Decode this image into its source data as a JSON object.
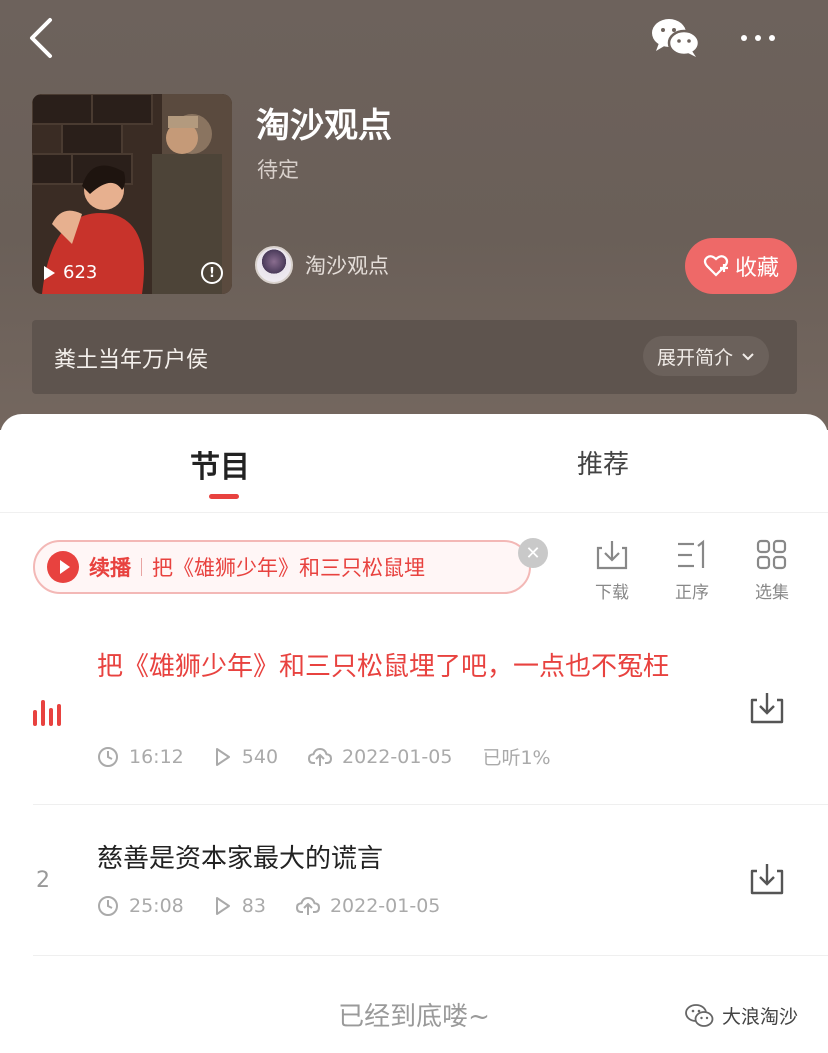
{
  "header": {
    "album_title": "淘沙观点",
    "album_status": "待定",
    "play_count": "623",
    "author_name": "淘沙观点",
    "favorite_label": "收藏",
    "description": "粪土当年万户侯",
    "expand_label": "展开简介"
  },
  "tabs": [
    {
      "label": "节目",
      "active": true
    },
    {
      "label": "推荐",
      "active": false
    }
  ],
  "resume_bar": {
    "label": "续播",
    "title": "把《雄狮少年》和三只松鼠埋"
  },
  "toolbar": {
    "download": "下载",
    "order": "正序",
    "select": "选集"
  },
  "episodes": [
    {
      "number": "",
      "title": "把《雄狮少年》和三只松鼠埋了吧，一点也不冤枉",
      "duration": "16:12",
      "plays": "540",
      "date": "2022-01-05",
      "progress": "已听1%",
      "playing": true
    },
    {
      "number": "2",
      "title": "慈善是资本家最大的谎言",
      "duration": "25:08",
      "plays": "83",
      "date": "2022-01-05",
      "progress": "",
      "playing": false
    }
  ],
  "footer": {
    "end_text": "已经到底喽~",
    "watermark": "大浪淘沙"
  },
  "colors": {
    "accent": "#e8423f",
    "favorite": "#ee6968",
    "header_bg": "#6d625c"
  }
}
